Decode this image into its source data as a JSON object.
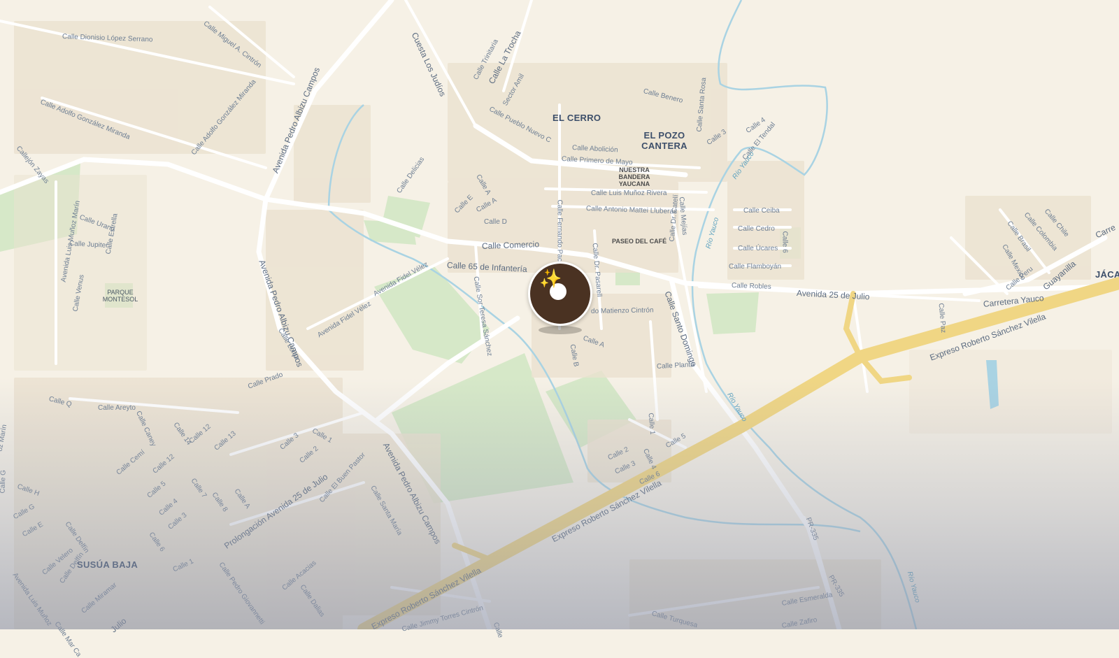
{
  "map": {
    "street_labels": {
      "dionisio": "Calle Dionisio López Serrano",
      "miguel": "Calle Miguel A. Cintrón",
      "cuesta": "Cuesta Los Judíos",
      "trinitaria": "Calle Trinitaria",
      "trocha": "Calle La Trocha",
      "sector_amil": "Sector Amil",
      "benero": "Calle Benero",
      "pueblo_nuevo": "Calle Pueblo Nuevo C",
      "abolicion": "Calle Abolición",
      "primero_mayo": "Calle Primero de Mayo",
      "santa_rosa": "Calle Santa Rosa",
      "calle3": "Calle 3",
      "calle4": "Calle 4",
      "el_tendal": "Calle El Tendal",
      "adolfo1": "Calle Adolfo González Miranda",
      "adolfo2": "Calle Adolfo González Miranda",
      "callejon": "Callejón Zayas",
      "avenida_pac_north": "Avenida Pedro Albizu Campos",
      "delicias": "Calle Delicias",
      "calle_a1": "Calle A",
      "calle_e": "Calle E",
      "calle_a2": "Calle A",
      "calle_d": "Calle D",
      "fernando": "Calle Fernando Pac",
      "munoz_rivera": "Calle Luis Muñoz Rivera",
      "mattei": "Calle Antonio Mattei Lluberas",
      "mejias": "Calle Mejías",
      "ceiba": "Calle Ceiba",
      "cedro": "Calle Cedro",
      "calle6": "Calle 6",
      "ucares": "Calle Úcares",
      "flamboyan": "Calle Flamboyán",
      "robles": "Calle Robles",
      "comercio": "Calle Comercio",
      "calle65": "Calle 65 de Infantería",
      "fidel1": "Avenida Fidel Vélez",
      "fidel2": "Avenida Fidel Vélez",
      "dr_pasarell": "Calle Dr. Pasarell",
      "dr_cateli": "Calle Dr. Catelí",
      "avenida25": "Avenida 25 de Julio",
      "carretera_yauco": "Carretera Yauco",
      "guayanilla": "Guayanilla",
      "calle_paz": "Calle Paz",
      "urano": "Calle Urano",
      "jupiter": "Calle Jupiter",
      "estrella": "Calle Estrella",
      "luis_munoz_marin": "Avenida Luis Muñoz Marín",
      "venus": "Calle Venus",
      "avenida_pac_mid": "Avenida Pedro Albizu Campos",
      "loma": "Calle Loma",
      "sor_teresa": "Calle Sor Teresa Sánchez",
      "matienzo": "do Matienzo Cintrón",
      "calle_a3": "Calle A",
      "calle_b": "Calle B",
      "santo_domingo": "Calle Santo Domingo",
      "planta": "Calle Planta",
      "expreso1": "Expreso Roberto Sánchez Vilella",
      "expreso2": "Expreso Roberto Sánchez Vilella",
      "expreso3": "Expreso Roberto Sánchez Vilella",
      "prado": "Calle Prado",
      "calle_q": "Calle Q",
      "areyto": "Calle Areyto",
      "caney": "Calle Caney",
      "cemi": "Calle Cemí",
      "calle14": "Calle 14",
      "calle12": "Calle 12",
      "calle13": "Calle 13",
      "calle3b": "Calle 3",
      "calle2": "Calle 2",
      "calle1": "Calle 1",
      "calle12b": "Calle 12",
      "calle5": "Calle 5",
      "calle7": "Calle 7",
      "calle4b": "Calle 4",
      "calle8": "Calle 8",
      "calle3c": "Calle 3",
      "calle6b": "Calle 6",
      "calle_a4": "Calle A",
      "prolongacion": "Prolongación Avenida 25 de Julio",
      "buen_pastor": "Calle El Buen Pastor",
      "santa_maria": "Calle Santa María",
      "avenida_pac_south": "Avenida Pedro Albizu Campos",
      "calle_h": "Calle H",
      "calle_g": "Calle G",
      "calle_e2": "Calle E",
      "delfin1": "Calle Delfín",
      "velero": "Calle Velero",
      "delfin2": "Calle Delfín",
      "calle1b": "Calle 1",
      "miramar": "Calle Miramar",
      "pedro_giovannetti": "Calle Pedro Giovannetti",
      "acacias": "Calle Acacias",
      "dalias": "Calle Dalias",
      "jimmy": "Calle Jimmy Torres Cintrón",
      "calle1c": "Calle 1",
      "calle5b": "Calle 5",
      "calle2b": "Calle 2",
      "calle3d": "Calle 3",
      "calle4c": "Calle 4",
      "calle6c": "Calle 6",
      "pr335a": "PR-335",
      "pr335b": "PR-335",
      "esmeralda": "Calle Esmeralda",
      "turquesa": "Calle Turquesa",
      "zafiro": "Calle Zafiro",
      "brasil": "Calle Brasil",
      "colombia": "Calle Colombia",
      "chile": "Calle Chile",
      "mexico": "Calle Mexico",
      "peru": "Calle Peru",
      "carre_edge": "Carre",
      "munoz_edge": "Avenida Luis Muñoz",
      "julio_edge": "Julio",
      "marin_edge": "oz Marín",
      "calle_g_edge": "Calle G",
      "mar_edge": "Calle Mar Ca",
      "calle_edge": "Calle"
    },
    "river_labels": {
      "yauco1": "Río Yauco",
      "yauco2": "Río Yauco",
      "yauco3": "Río Yauco",
      "yauco4": "Río Yauco"
    },
    "neighborhoods": {
      "el_cerro": "EL CERRO",
      "el_pozo": "EL POZO CANTERA",
      "susua": "SUSÚA BAJA",
      "jaca": "JÁCA"
    },
    "places": {
      "nuestra_bandera": "NUESTRA BANDERA YAUCANA",
      "paseo_cafe": "PASEO DEL CAFÉ",
      "parque_montesol": "PARQUE MONTESOL"
    },
    "colors": {
      "background": "#f6f1e6",
      "park": "#d6e8c8",
      "road_minor": "#ffffff",
      "highway": "#f0d684",
      "river": "#a9d3e3",
      "marker_disc": "#4a3222",
      "marker_spark": "#f5c542"
    },
    "marker": {
      "icon": "sparkles-icon",
      "symbol": "✨"
    }
  }
}
